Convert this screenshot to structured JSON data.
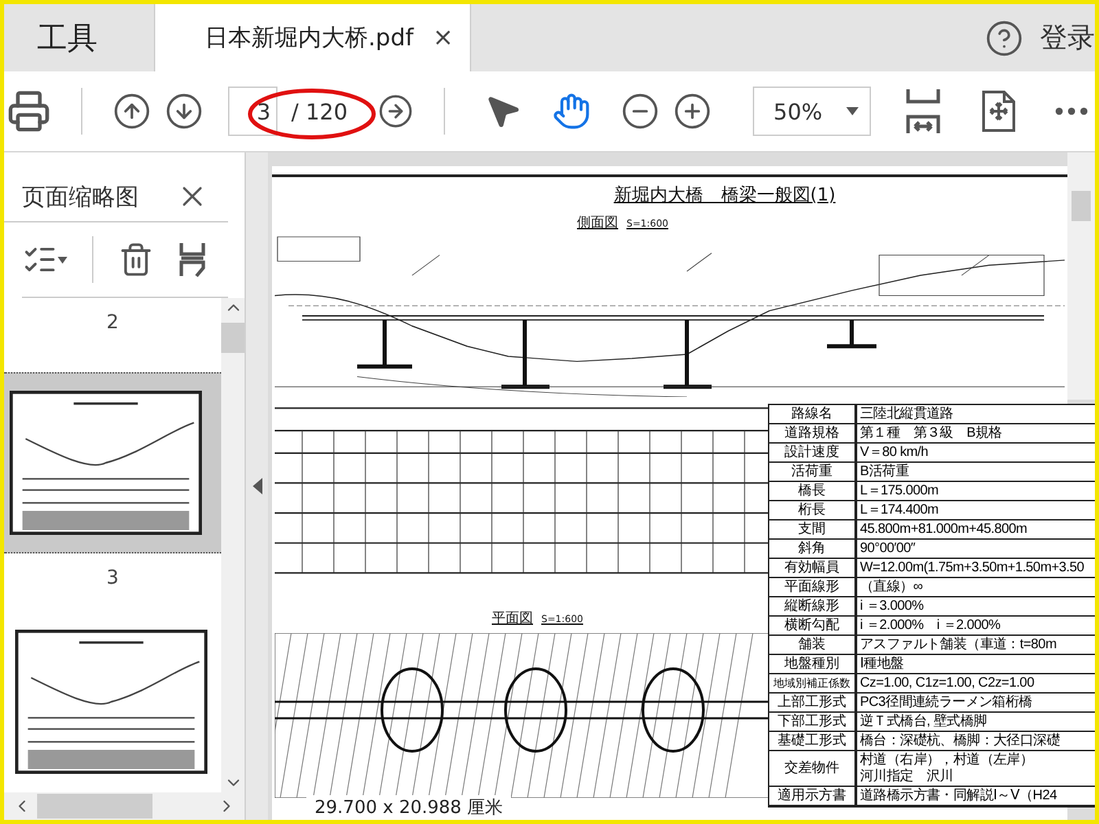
{
  "tabs": [
    {
      "label": "工具",
      "selected": false
    },
    {
      "label": "日本新堀内大桥.pdf",
      "selected": true,
      "close": "×"
    }
  ],
  "account": {
    "label": "登录"
  },
  "toolbar": {
    "page_field": {
      "value": "3"
    },
    "page_count": "/ 120",
    "tools": [
      {
        "kind": "select",
        "selected": false
      },
      {
        "kind": "hand",
        "selected": true
      }
    ],
    "zoom": {
      "value": "50%"
    }
  },
  "sidebar": {
    "title": "页面缩略图",
    "thumbnails": [
      {
        "kind": "caption",
        "label": "2",
        "selected": false
      },
      {
        "kind": "page",
        "label": "3",
        "selected": true
      },
      {
        "kind": "partial",
        "selected": false
      }
    ]
  },
  "document": {
    "title": "新堀内大橋　橋梁一般図(1)",
    "views": [
      {
        "title": "側面図",
        "scale": "S=1:600"
      },
      {
        "title": "平面図",
        "scale": "S=1:600"
      }
    ],
    "spec_table": {
      "rows": [
        {
          "label": "路線名",
          "values": [
            "三陸北縦貫道路"
          ]
        },
        {
          "label": "道路規格",
          "values": [
            "第１種　第３級　B規格"
          ]
        },
        {
          "label": "設計速度",
          "values": [
            "V＝80 km/h"
          ]
        },
        {
          "label": "活荷重",
          "values": [
            "B活荷重"
          ]
        },
        {
          "label": "橋長",
          "values": [
            "L＝175.000m"
          ]
        },
        {
          "label": "桁長",
          "values": [
            "L＝174.400m"
          ]
        },
        {
          "label": "支間",
          "values": [
            "45.800m+81.000m+45.800m"
          ]
        },
        {
          "label": "斜角",
          "values": [
            "90°00′00″"
          ]
        },
        {
          "label": "有効幅員",
          "values": [
            "W=12.00m(1.75m+3.50m+1.50m+3.50"
          ]
        },
        {
          "label": "平面線形",
          "values": [
            "（直線）∞"
          ]
        },
        {
          "label": "縦断線形",
          "values": [
            "i ＝3.000%"
          ]
        },
        {
          "label": "横断勾配",
          "values": [
            "i ＝2.000%　i ＝2.000%"
          ]
        },
        {
          "label": "舗装",
          "values": [
            "アスファルト舗装（車道：t=80m"
          ]
        },
        {
          "label": "地盤種別",
          "values": [
            "Ⅰ種地盤"
          ]
        },
        {
          "label": "地域別補正係数",
          "values": [
            "Cz=1.00, C1z=1.00, C2z=1.00"
          ]
        },
        {
          "label": "上部工形式",
          "values": [
            "PC3径間連続ラーメン箱桁橋"
          ]
        },
        {
          "label": "下部工形式",
          "values": [
            "逆Ｔ式橋台, 壁式橋脚"
          ]
        },
        {
          "label": "基礎工形式",
          "values": [
            "橋台：深礎杭、橋脚：大径口深礎"
          ]
        },
        {
          "label": "交差物件",
          "values": [
            "村道（右岸），村道（左岸）",
            "河川指定　沢川"
          ]
        },
        {
          "label": "適用示方書",
          "values": [
            "道路橋示方書・同解説Ⅰ～Ⅴ（H24"
          ]
        }
      ]
    },
    "page_size": "29.700 x 20.988 厘米"
  }
}
